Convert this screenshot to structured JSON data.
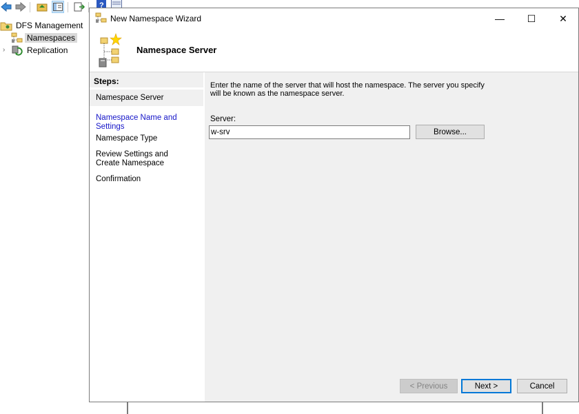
{
  "mmc": {
    "tree": {
      "root_label": "DFS Management",
      "items": [
        {
          "label": "Namespaces",
          "selected": true
        },
        {
          "label": "Replication",
          "selected": false
        }
      ]
    }
  },
  "wizard": {
    "title": "New Namespace Wizard",
    "window_buttons": {
      "minimize": "—",
      "maximize": "☐",
      "close": "✕"
    },
    "page_title": "Namespace Server",
    "steps_label": "Steps:",
    "steps": [
      {
        "label": "Namespace Server",
        "state": "current"
      },
      {
        "label": "Namespace Name and Settings",
        "state": "link"
      },
      {
        "label": "Namespace Type",
        "state": "normal"
      },
      {
        "label": "Review Settings and Create Namespace",
        "state": "normal"
      },
      {
        "label": "Confirmation",
        "state": "normal"
      }
    ],
    "intro_text": "Enter the name of the server that will host the namespace. The server you specify will be known as the namespace server.",
    "server_label": "Server:",
    "server_value": "w-srv",
    "browse_label": "Browse...",
    "previous_label": "< Previous",
    "next_label": "Next >",
    "cancel_label": "Cancel"
  },
  "colors": {
    "link": "#1515c8",
    "default_button_border": "#0078d7",
    "dialog_bg": "#f0f0f0"
  },
  "icons": {
    "toolbar": [
      "back-arrow-icon",
      "forward-arrow-icon",
      "up-folder-icon",
      "show-hide-tree-icon",
      "export-list-icon",
      "help-icon",
      "console-icon"
    ],
    "tree": [
      "dfs-management-icon",
      "namespaces-icon",
      "replication-icon"
    ],
    "wizard": [
      "wizard-app-icon",
      "namespace-server-icon"
    ]
  }
}
